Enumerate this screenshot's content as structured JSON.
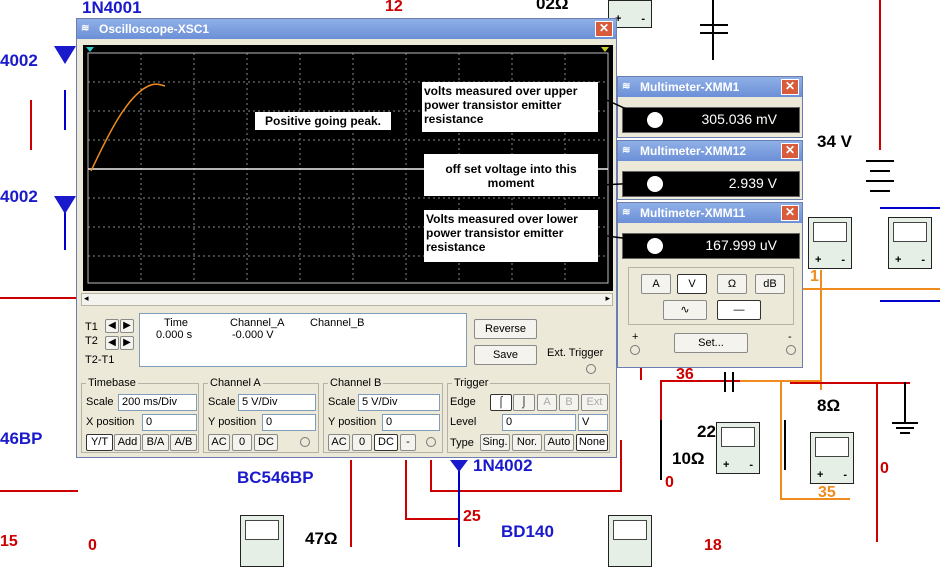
{
  "schematic": {
    "labels_blue": [
      "1N4001",
      "4002",
      "4002",
      "46BP",
      "BC546BP",
      "1N4002",
      "BD140"
    ],
    "labels_red": [
      "12",
      "15",
      "0",
      "25",
      "0",
      "36",
      "0",
      "18"
    ],
    "labels_black": [
      "02Ω",
      "34 V",
      "8Ω",
      "10Ω",
      "47Ω",
      "22"
    ],
    "labels_orange": [
      "1",
      "35"
    ]
  },
  "oscilloscope": {
    "title": "Oscilloscope-XSC1",
    "annotations": {
      "peak": "Positive going peak.",
      "upper": "volts measured over upper power transistor emitter resistance",
      "offset": "off set voltage into this moment",
      "lower": "Volts measured over lower power transistor emitter resistance"
    },
    "cursors": {
      "t1": "T1",
      "t2": "T2",
      "t2t1": "T2-T1"
    },
    "readout": {
      "col_time": "Time",
      "col_a": "Channel_A",
      "col_b": "Channel_B",
      "time_val": "0.000 s",
      "a_val": "-0.000 V"
    },
    "buttons": {
      "reverse": "Reverse",
      "save": "Save",
      "ext_trigger": "Ext. Trigger"
    },
    "timebase": {
      "title": "Timebase",
      "scale_label": "Scale",
      "scale_val": "200 ms/Div",
      "xpos_label": "X position",
      "xpos_val": "0",
      "modes": [
        "Y/T",
        "Add",
        "B/A",
        "A/B"
      ]
    },
    "channel_a": {
      "title": "Channel A",
      "scale_label": "Scale",
      "scale_val": "5  V/Div",
      "ypos_label": "Y position",
      "ypos_val": "0",
      "coupling": [
        "AC",
        "0",
        "DC"
      ]
    },
    "channel_b": {
      "title": "Channel B",
      "scale_label": "Scale",
      "scale_val": "5  V/Div",
      "ypos_label": "Y position",
      "ypos_val": "0",
      "coupling": [
        "AC",
        "0",
        "DC",
        "-"
      ]
    },
    "trigger": {
      "title": "Trigger",
      "edge_label": "Edge",
      "edge_buttons": [
        "A",
        "B",
        "Ext"
      ],
      "level_label": "Level",
      "level_val": "0",
      "level_unit": "V",
      "type_label": "Type",
      "types": [
        "Sing.",
        "Nor.",
        "Auto",
        "None"
      ]
    }
  },
  "multimeters": [
    {
      "title": "Multimeter-XMM1",
      "value": "305.036 mV"
    },
    {
      "title": "Multimeter-XMM12",
      "value": "2.939 V"
    },
    {
      "title": "Multimeter-XMM11",
      "value": "167.999 uV"
    }
  ],
  "multimeter_controls": {
    "modes": [
      "A",
      "V",
      "Ω",
      "dB"
    ],
    "set_button": "Set...",
    "plus": "+",
    "minus": "-"
  },
  "colors": {
    "trace": "#f08c1e",
    "screen": "#000000",
    "title_gradient": "#6c8fd8"
  }
}
